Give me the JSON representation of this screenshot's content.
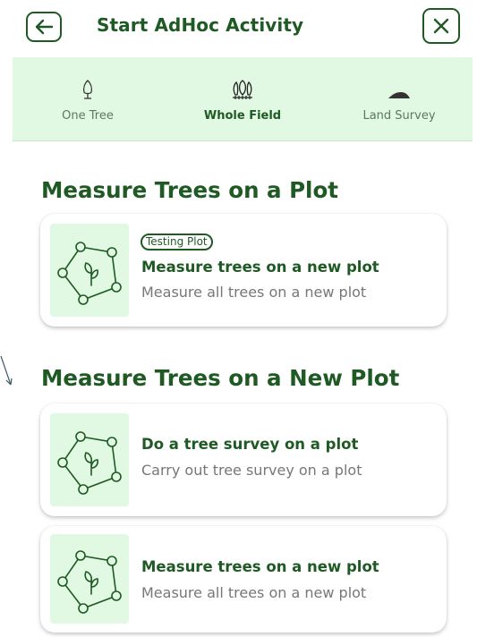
{
  "header": {
    "title": "Start AdHoc Activity",
    "back_icon": "arrow-left-icon",
    "close_icon": "close-icon"
  },
  "tabs": [
    {
      "label": "One Tree",
      "icon": "tree-outline-icon",
      "active": false
    },
    {
      "label": "Whole Field",
      "icon": "field-trees-icon",
      "active": true
    },
    {
      "label": "Land Survey",
      "icon": "land-mound-icon",
      "active": false
    }
  ],
  "sections": [
    {
      "title": "Measure Trees on a Plot",
      "cards": [
        {
          "badge": "Testing Plot",
          "title": "Measure trees on a new plot",
          "subtitle": "Measure all trees on a new plot",
          "icon": "plot-sprout-icon"
        }
      ]
    },
    {
      "title": "Measure Trees on a New Plot",
      "cards": [
        {
          "title": "Do a tree survey on a plot",
          "subtitle": "Carry out tree survey on a plot",
          "icon": "plot-sprout-icon"
        },
        {
          "title": "Measure trees on a new plot",
          "subtitle": "Measure all trees on a new plot",
          "icon": "plot-sprout-icon"
        }
      ]
    }
  ],
  "colors": {
    "primary": "#1f5a24",
    "tab_background": "#e1f8e2",
    "subtitle": "#777777"
  }
}
